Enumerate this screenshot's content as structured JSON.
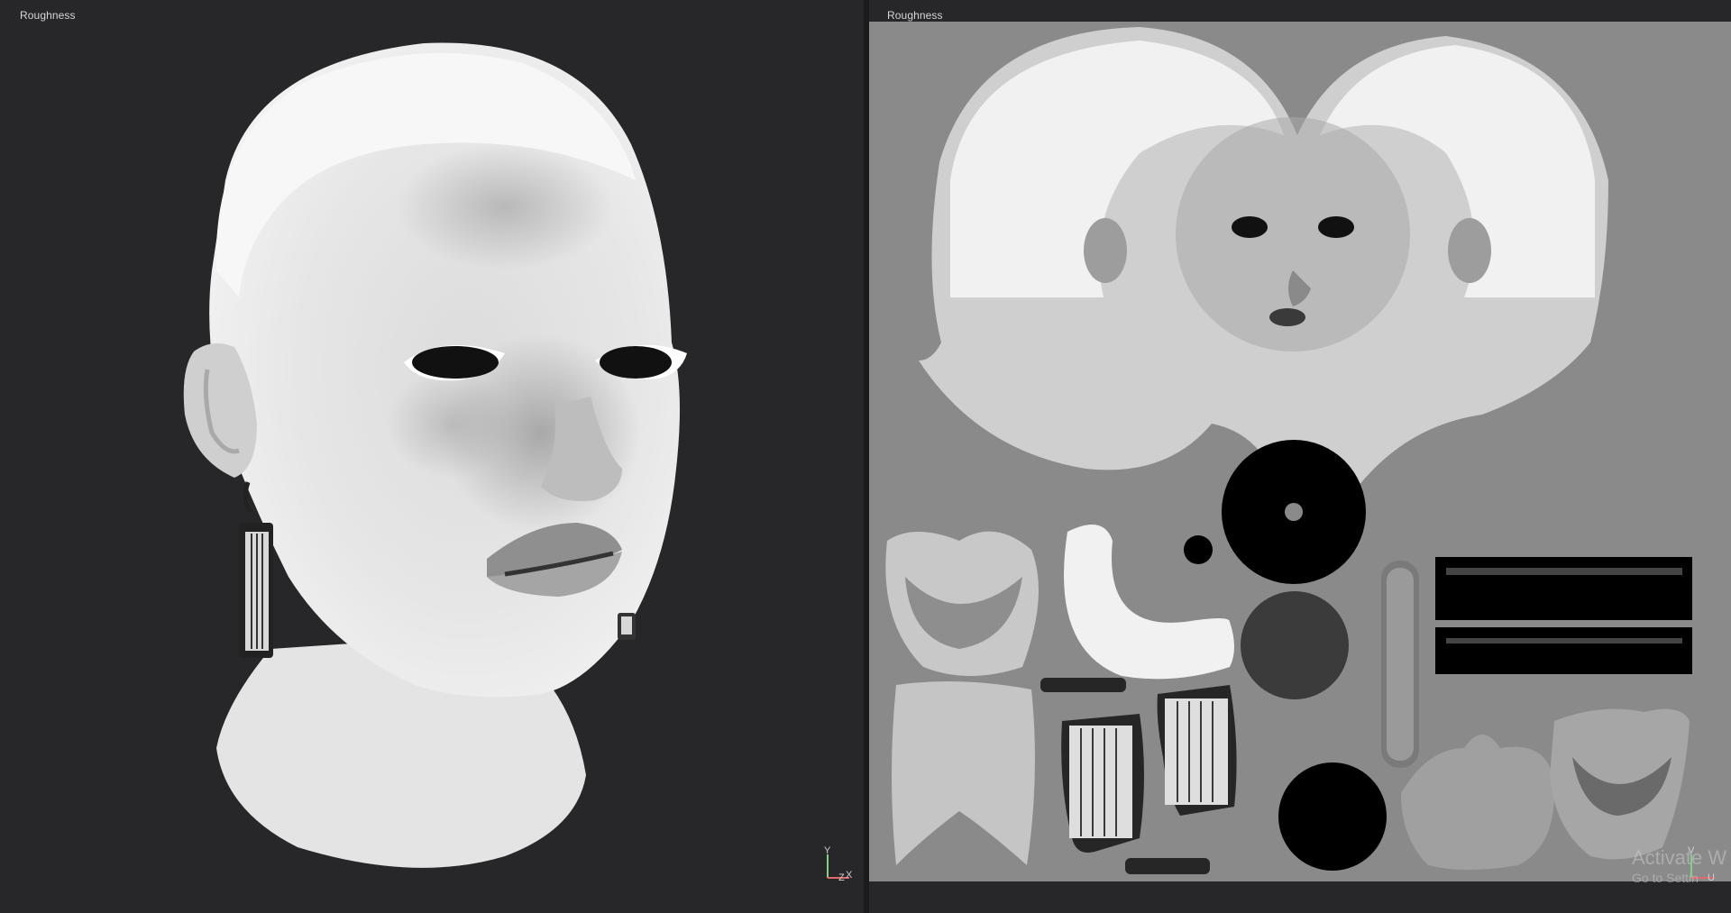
{
  "left_viewport": {
    "label": "Roughness",
    "gizmo": {
      "axis_y": "Y",
      "axis_z": "Z",
      "axis_x": "X"
    }
  },
  "right_viewport": {
    "label": "Roughness",
    "gizmo": {
      "axis_y": "V",
      "axis_u": "U"
    }
  },
  "watermark": {
    "title": "Activate W",
    "subtitle": "Go to Settin"
  },
  "colors": {
    "background": "#262629",
    "uv_background": "#8a8a8a",
    "gizmo_y": "#7fd27f",
    "gizmo_x": "#e06a6a"
  }
}
